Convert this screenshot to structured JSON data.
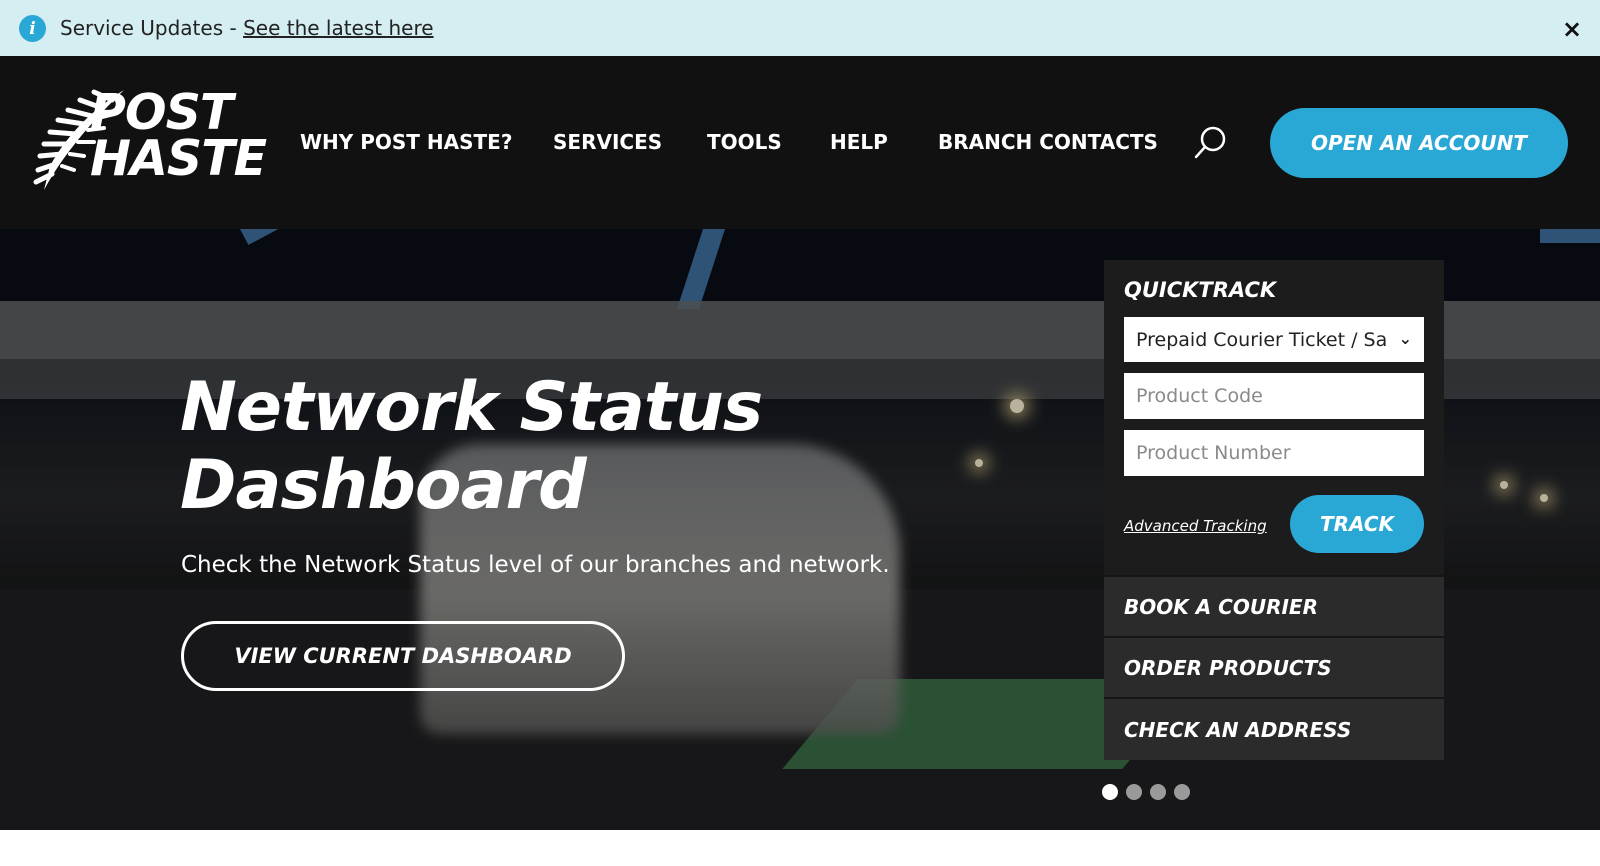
{
  "alert": {
    "prefix": "Service Updates - ",
    "link_text": "See the latest here",
    "close_label": "×",
    "icon": "info-icon"
  },
  "header": {
    "logo_line1": "POST",
    "logo_line2": "HASTE",
    "nav": [
      {
        "label": "WHY POST HASTE?"
      },
      {
        "label": "SERVICES"
      },
      {
        "label": "TOOLS"
      },
      {
        "label": "HELP"
      },
      {
        "label": "BRANCH CONTACTS"
      }
    ],
    "search_icon": "search-icon",
    "open_account_label": "OPEN AN ACCOUNT"
  },
  "hero": {
    "title_line1": "Network Status",
    "title_line2": "Dashboard",
    "subtitle": "Check the Network Status level of our branches and network.",
    "cta_label": "VIEW CURRENT DASHBOARD"
  },
  "quicktrack": {
    "title": "QUICKTRACK",
    "select_value": "Prepaid Courier Ticket / Satchel",
    "product_code_placeholder": "Product Code",
    "product_number_placeholder": "Product Number",
    "advanced_link": "Advanced Tracking",
    "track_label": "TRACK",
    "links": [
      {
        "label": "BOOK A COURIER"
      },
      {
        "label": "ORDER PRODUCTS"
      },
      {
        "label": "CHECK AN ADDRESS"
      }
    ]
  },
  "carousel": {
    "slide_count": 4,
    "active_index": 0
  },
  "colors": {
    "accent": "#29a8d6",
    "header_bg": "#111111",
    "alert_bg": "#d4eef2",
    "panel_bg": "#1c1c1c"
  }
}
